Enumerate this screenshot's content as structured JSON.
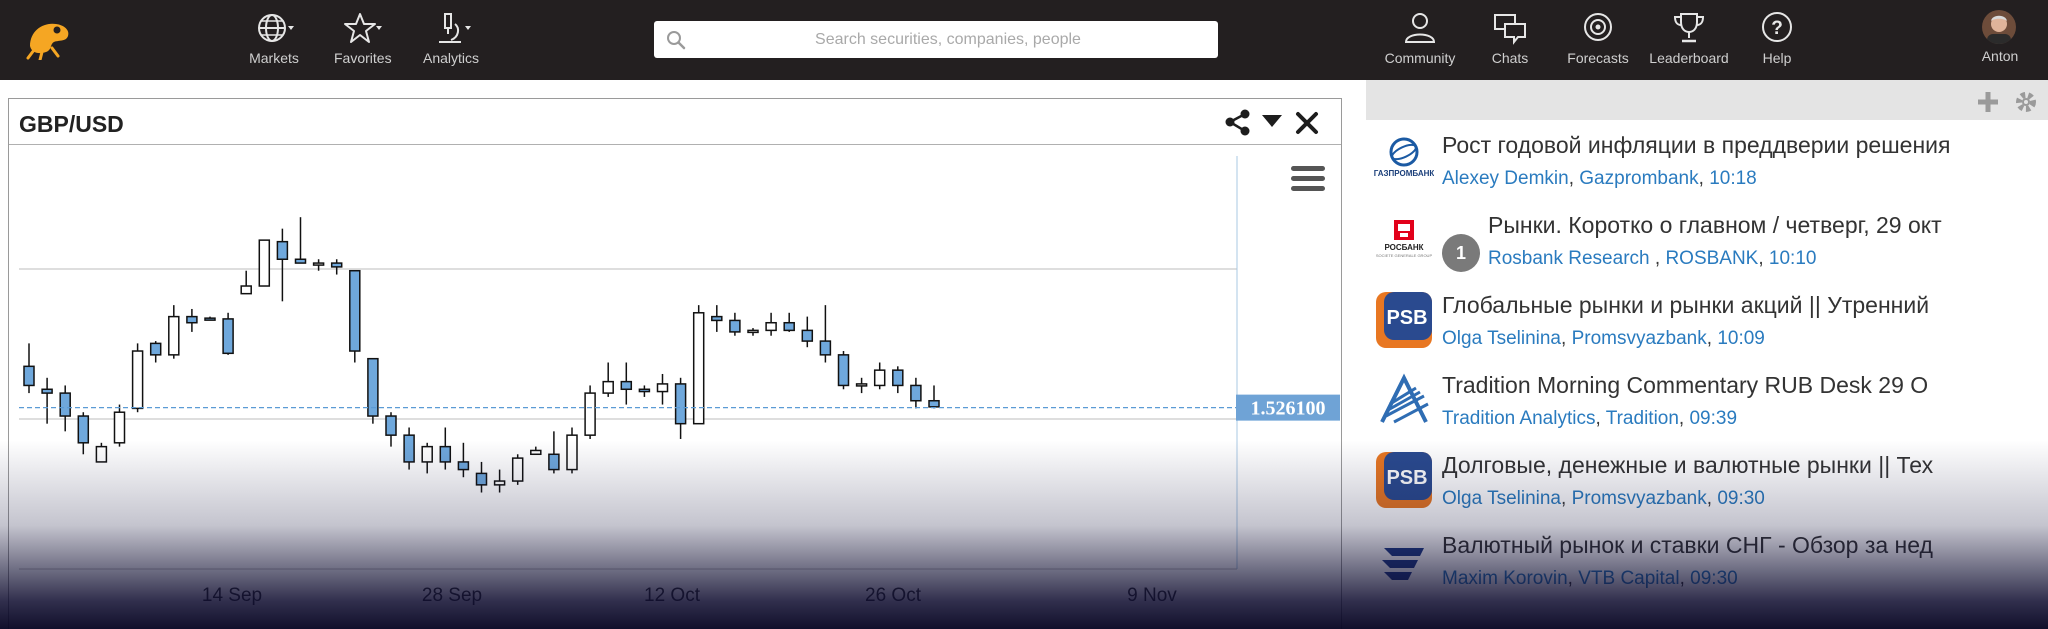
{
  "nav": {
    "markets": "Markets",
    "favorites": "Favorites",
    "analytics": "Analytics",
    "community": "Community",
    "chats": "Chats",
    "forecasts": "Forecasts",
    "leaderboard": "Leaderboard",
    "help": "Help",
    "user": "Anton"
  },
  "search": {
    "placeholder": "Search securities, companies, people"
  },
  "panel": {
    "title": "GBP/USD"
  },
  "chart_data": {
    "type": "candlestick",
    "x_tick_labels": [
      "14 Sep",
      "28 Sep",
      "12 Oct",
      "26 Oct",
      "9 Nov"
    ],
    "ylim": [
      1.505,
      1.559
    ],
    "current_price_label": "1.526100",
    "current_price": 1.5261,
    "candles": [
      {
        "o": 1.5315,
        "h": 1.5345,
        "l": 1.528,
        "c": 1.529
      },
      {
        "o": 1.5285,
        "h": 1.53,
        "l": 1.524,
        "c": 1.528
      },
      {
        "o": 1.528,
        "h": 1.529,
        "l": 1.523,
        "c": 1.525
      },
      {
        "o": 1.525,
        "h": 1.5255,
        "l": 1.52,
        "c": 1.5215
      },
      {
        "o": 1.519,
        "h": 1.5215,
        "l": 1.519,
        "c": 1.521
      },
      {
        "o": 1.5215,
        "h": 1.5265,
        "l": 1.521,
        "c": 1.5255
      },
      {
        "o": 1.526,
        "h": 1.5345,
        "l": 1.5255,
        "c": 1.5335
      },
      {
        "o": 1.5345,
        "h": 1.5348,
        "l": 1.532,
        "c": 1.533
      },
      {
        "o": 1.533,
        "h": 1.5395,
        "l": 1.5325,
        "c": 1.538
      },
      {
        "o": 1.538,
        "h": 1.539,
        "l": 1.536,
        "c": 1.5372
      },
      {
        "o": 1.5378,
        "h": 1.538,
        "l": 1.5376,
        "c": 1.5377
      },
      {
        "o": 1.5377,
        "h": 1.5385,
        "l": 1.533,
        "c": 1.5332
      },
      {
        "o": 1.541,
        "h": 1.544,
        "l": 1.542,
        "c": 1.542
      },
      {
        "o": 1.542,
        "h": 1.544,
        "l": 1.542,
        "c": 1.548
      },
      {
        "o": 1.5478,
        "h": 1.5495,
        "l": 1.54,
        "c": 1.5455
      },
      {
        "o": 1.5455,
        "h": 1.551,
        "l": 1.5455,
        "c": 1.545
      },
      {
        "o": 1.545,
        "h": 1.5455,
        "l": 1.544,
        "c": 1.545
      },
      {
        "o": 1.545,
        "h": 1.5455,
        "l": 1.5435,
        "c": 1.5445
      },
      {
        "o": 1.544,
        "h": 1.544,
        "l": 1.532,
        "c": 1.5335
      },
      {
        "o": 1.5325,
        "h": 1.5325,
        "l": 1.524,
        "c": 1.525
      },
      {
        "o": 1.525,
        "h": 1.5255,
        "l": 1.521,
        "c": 1.5225
      },
      {
        "o": 1.5225,
        "h": 1.5235,
        "l": 1.518,
        "c": 1.519
      },
      {
        "o": 1.519,
        "h": 1.5215,
        "l": 1.5175,
        "c": 1.521
      },
      {
        "o": 1.521,
        "h": 1.5235,
        "l": 1.518,
        "c": 1.519
      },
      {
        "o": 1.519,
        "h": 1.5215,
        "l": 1.517,
        "c": 1.518
      },
      {
        "o": 1.5175,
        "h": 1.519,
        "l": 1.515,
        "c": 1.516
      },
      {
        "o": 1.516,
        "h": 1.518,
        "l": 1.515,
        "c": 1.5165
      },
      {
        "o": 1.5165,
        "h": 1.52,
        "l": 1.516,
        "c": 1.5195
      },
      {
        "o": 1.52,
        "h": 1.521,
        "l": 1.52,
        "c": 1.5205
      },
      {
        "o": 1.52,
        "h": 1.523,
        "l": 1.5175,
        "c": 1.518
      },
      {
        "o": 1.518,
        "h": 1.5235,
        "l": 1.5175,
        "c": 1.5225
      },
      {
        "o": 1.5225,
        "h": 1.529,
        "l": 1.522,
        "c": 1.528
      },
      {
        "o": 1.528,
        "h": 1.532,
        "l": 1.5275,
        "c": 1.5295
      },
      {
        "o": 1.5295,
        "h": 1.532,
        "l": 1.5265,
        "c": 1.5285
      },
      {
        "o": 1.5285,
        "h": 1.529,
        "l": 1.5275,
        "c": 1.5282
      },
      {
        "o": 1.5282,
        "h": 1.5305,
        "l": 1.5265,
        "c": 1.5292
      },
      {
        "o": 1.5292,
        "h": 1.53,
        "l": 1.522,
        "c": 1.524
      },
      {
        "o": 1.524,
        "h": 1.5395,
        "l": 1.524,
        "c": 1.5385
      },
      {
        "o": 1.538,
        "h": 1.5395,
        "l": 1.536,
        "c": 1.5375
      },
      {
        "o": 1.5375,
        "h": 1.5385,
        "l": 1.5355,
        "c": 1.536
      },
      {
        "o": 1.536,
        "h": 1.5365,
        "l": 1.5355,
        "c": 1.5362
      },
      {
        "o": 1.5362,
        "h": 1.5385,
        "l": 1.5355,
        "c": 1.5372
      },
      {
        "o": 1.5372,
        "h": 1.5385,
        "l": 1.536,
        "c": 1.5362
      },
      {
        "o": 1.5362,
        "h": 1.538,
        "l": 1.534,
        "c": 1.5348
      },
      {
        "o": 1.5348,
        "h": 1.5395,
        "l": 1.532,
        "c": 1.533
      },
      {
        "o": 1.533,
        "h": 1.5335,
        "l": 1.5285,
        "c": 1.529
      },
      {
        "o": 1.529,
        "h": 1.53,
        "l": 1.528,
        "c": 1.5292
      },
      {
        "o": 1.529,
        "h": 1.532,
        "l": 1.5285,
        "c": 1.531
      },
      {
        "o": 1.531,
        "h": 1.5315,
        "l": 1.528,
        "c": 1.529
      },
      {
        "o": 1.529,
        "h": 1.53,
        "l": 1.526,
        "c": 1.527
      },
      {
        "o": 1.527,
        "h": 1.529,
        "l": 1.526,
        "c": 1.5262
      }
    ]
  },
  "news": [
    {
      "title": "Рост годовой инфляции в преддверии решения",
      "author": "Alexey Demkin",
      "sep1": ", ",
      "company": "Gazprombank",
      "sep2": ", ",
      "time": "10:18",
      "logo": "gazprombank-logo"
    },
    {
      "title": "Рынки. Коротко о главном / четверг, 29 окт",
      "author": "Rosbank Research",
      "sep1": " , ",
      "company": "ROSBANK",
      "sep2": ", ",
      "time": "10:10",
      "logo": "rosbank-logo",
      "badge": "1"
    },
    {
      "title": "Глобальные рынки и рынки акций || Утренний",
      "author": "Olga Tselinina",
      "sep1": ", ",
      "company": "Promsvyazbank",
      "sep2": ", ",
      "time": "10:09",
      "logo": "psb-logo"
    },
    {
      "title": "Tradition Morning Commentary RUB Desk 29 O",
      "author": "Tradition Analytics",
      "sep1": ", ",
      "company": "Tradition",
      "sep2": ", ",
      "time": "09:39",
      "logo": "tradition-logo"
    },
    {
      "title": "Долговые, денежные и валютные рынки || Тех",
      "author": "Olga Tselinina",
      "sep1": ", ",
      "company": "Promsvyazbank",
      "sep2": ", ",
      "time": "09:30",
      "logo": "psb-logo"
    },
    {
      "title": "Валютный рынок и ставки СНГ - Обзор за нед",
      "author": "Maxim Korovin",
      "sep1": ", ",
      "company": "VTB Capital",
      "sep2": ", ",
      "time": "09:30",
      "logo": "vtb-logo"
    }
  ],
  "colors": {
    "navbar": "#231f20",
    "accent_blue": "#2a7bbf",
    "candle_down": "#6fa8dc",
    "price_tag": "#6fa3d6"
  }
}
